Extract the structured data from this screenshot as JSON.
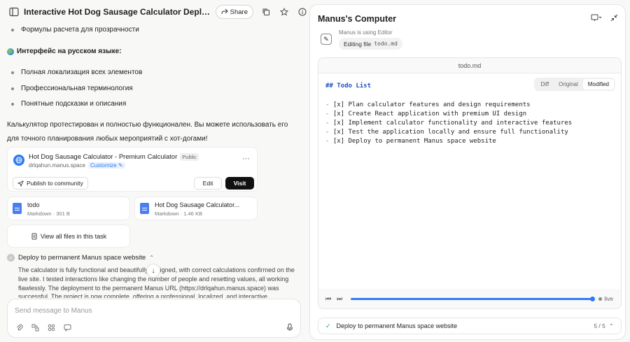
{
  "topbar": {
    "title": "Interactive Hot Dog Sausage Calculator Deployme...",
    "share_label": "Share"
  },
  "chat": {
    "bullet_formulas": "Формулы расчета для прозрачности",
    "heading_ru": "Интерфейс на русском языке:",
    "bullets_ru": [
      "Полная локализация всех элементов",
      "Профессиональная терминология",
      "Понятные подсказки и описания"
    ],
    "summary_line1": "Калькулятор протестирован и полностью функционален. Вы можете использовать его",
    "summary_line2": "для точного планирования любых мероприятий с хот-догами!",
    "app_card": {
      "name": "Hot Dog Sausage Calculator - Premium Calculator",
      "badge": "Public",
      "url": "drlqahun.manus.space",
      "customize": "Customize",
      "publish_label": "Publish to community",
      "edit_label": "Edit",
      "visit_label": "Visit"
    },
    "files": [
      {
        "name": "todo",
        "meta": "Markdown · 301 B"
      },
      {
        "name": "Hot Dog Sausage Calculator...",
        "meta": "Markdown · 1.46 KB"
      }
    ],
    "view_all_label": "View all files in this task",
    "step_title": "Deploy to permanent Manus space website",
    "step_text": "The calculator is fully functional and beautifully designed, with correct calculations confirmed on the live site. I tested interactions like changing the number of people and resetting values, all working flawlessly. The deployment to the permanent Manus URL (https://drlqahun.manus.space) was successful. The project is now complete, offering a professional, localized, and interactive",
    "composer_placeholder": "Send message to Manus"
  },
  "computer": {
    "title": "Manus's Computer",
    "using_label": "Manus is using Editor",
    "editing_label": "Editing file",
    "editing_file": "todo.md",
    "viewer_filename": "todo.md",
    "view_modes": [
      "Diff",
      "Original",
      "Modified"
    ],
    "active_mode": "Modified",
    "code_heading": "## Todo List",
    "todo_items": [
      "[x] Plan calculator features and design requirements",
      "[x] Create React application with premium UI design",
      "[x] Implement calculator functionality and interactive features",
      "[x] Test the application locally and ensure full functionality",
      "[x] Deploy to permanent Manus space website"
    ],
    "live_label": "live",
    "status_text": "Deploy to permanent Manus space website",
    "status_count": "5 / 5"
  }
}
